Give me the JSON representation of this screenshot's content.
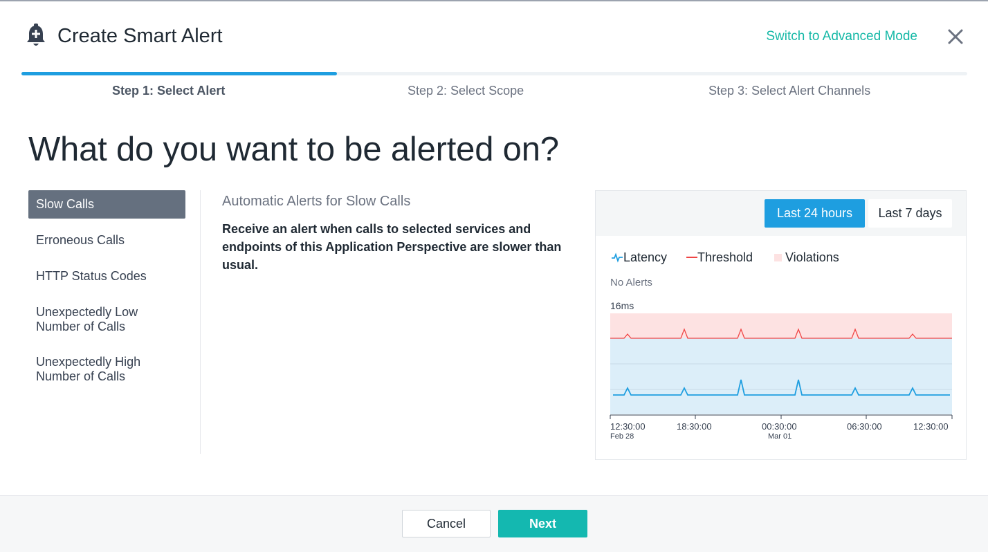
{
  "header": {
    "title": "Create Smart Alert",
    "advanced_link": "Switch to Advanced Mode",
    "icons": {
      "bell": "bell-plus-icon",
      "close": "close-icon"
    }
  },
  "steps": [
    {
      "label": "Step 1: Select Alert",
      "active": true
    },
    {
      "label": "Step 2: Select Scope",
      "active": false
    },
    {
      "label": "Step 3: Select Alert Channels",
      "active": false
    }
  ],
  "progress": {
    "fraction": 0.333
  },
  "question": "What do you want to be alerted on?",
  "menu": {
    "items": [
      {
        "label": "Slow Calls",
        "active": true
      },
      {
        "label": "Erroneous Calls",
        "active": false
      },
      {
        "label": "HTTP Status Codes",
        "active": false
      },
      {
        "label": "Unexpectedly Low Number of Calls",
        "active": false
      },
      {
        "label": "Unexpectedly High Number of Calls",
        "active": false
      }
    ]
  },
  "detail": {
    "subhead": "Automatic Alerts for Slow Calls",
    "description": "Receive an alert when calls to selected services and endpoints of this Application Perspective are slower than usual."
  },
  "chart_panel": {
    "range_buttons": [
      "Last 24 hours",
      "Last 7 days"
    ],
    "selected_range": "Last 24 hours",
    "legend": {
      "latency": "Latency",
      "threshold": "Threshold",
      "violations": "Violations"
    },
    "status": "No Alerts"
  },
  "chart_data": {
    "type": "line",
    "ylabel": "16ms",
    "x_tick_labels": [
      "12:30:00",
      "18:30:00",
      "00:30:00",
      "06:30:00",
      "12:30:00"
    ],
    "x_sub_labels": [
      "Feb 28",
      "",
      "Mar 01",
      "",
      ""
    ],
    "series": [
      {
        "name": "Threshold",
        "color": "#ef4444"
      },
      {
        "name": "Latency",
        "color": "#1e9ee0"
      }
    ],
    "colors": {
      "violations_band": "#fde2e2",
      "normal_band": "#dceef9"
    }
  },
  "footer": {
    "cancel_label": "Cancel",
    "next_label": "Next"
  },
  "colors": {
    "accent": "#1e9ee0",
    "primary_button": "#14b8b0",
    "link": "#14b8a6"
  }
}
